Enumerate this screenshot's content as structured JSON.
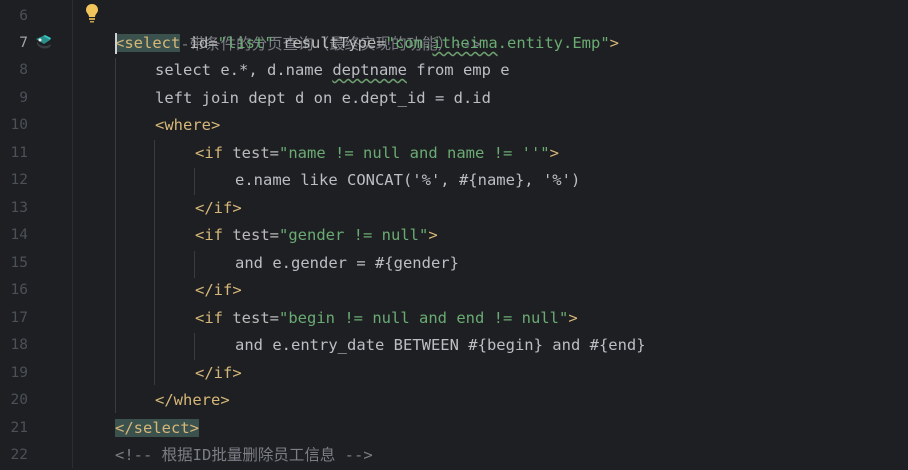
{
  "gutter": {
    "line_numbers": [
      "6",
      "7",
      "8",
      "9",
      "10",
      "11",
      "12",
      "13",
      "14",
      "15",
      "16",
      "17",
      "18",
      "19",
      "20",
      "21",
      "22"
    ],
    "current_line": "7"
  },
  "code": {
    "l6": {
      "comment": "<!--带条件的分页查询（最终实现的功能）-->"
    },
    "l7": {
      "open": "<select",
      "attr1": "id=",
      "val1": "\"list\"",
      "attr2": "resultType=",
      "val2a": "\"com.",
      "val2b": "itheima",
      "val2c": ".entity.Emp\"",
      "close": ">"
    },
    "l8": {
      "text1": "select e.*, d.name ",
      "text2": "deptname",
      "text3": " from emp e"
    },
    "l9": {
      "text": "left join dept d on e.dept_id = d.id"
    },
    "l10": {
      "tag": "<where>"
    },
    "l11": {
      "tag": "<if",
      "attr": "test=",
      "val": "\"name != null and name != ''\"",
      "close": ">"
    },
    "l12": {
      "text": "e.name like CONCAT('%', #{name}, '%')"
    },
    "l13": {
      "tag": "</if>"
    },
    "l14": {
      "tag": "<if",
      "attr": "test=",
      "val": "\"gender != null\"",
      "close": ">"
    },
    "l15": {
      "text": "and e.gender = #{gender}"
    },
    "l16": {
      "tag": "</if>"
    },
    "l17": {
      "tag": "<if",
      "attr": "test=",
      "val": "\"begin != null and end != null\"",
      "close": ">"
    },
    "l18": {
      "text": "and e.entry_date BETWEEN #{begin} and #{end}"
    },
    "l19": {
      "tag": "</if>"
    },
    "l20": {
      "tag": "</where>"
    },
    "l21": {
      "tag": "</select>"
    },
    "l22": {
      "comment": "<!-- 根据ID批量删除员工信息 -->"
    }
  },
  "icons": {
    "bulb": "intention-bulb-icon",
    "bean": "mybatis-mapper-icon"
  }
}
